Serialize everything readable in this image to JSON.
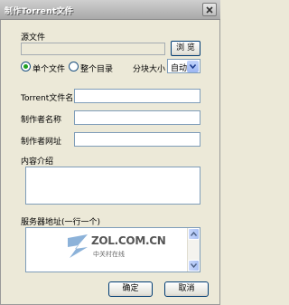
{
  "window": {
    "title": "制作Torrent文件"
  },
  "source": {
    "label": "源文件",
    "value": "",
    "browse_label": "浏 览"
  },
  "mode": {
    "single_file_label": "单个文件",
    "whole_dir_label": "整个目录",
    "selected": "single_file",
    "block_size_label": "分块大小",
    "block_size_value": "自动"
  },
  "fields": {
    "torrent_name_label": "Torrent文件名",
    "torrent_name_value": "",
    "creator_name_label": "制作者名称",
    "creator_name_value": "",
    "creator_url_label": "制作者网址",
    "creator_url_value": ""
  },
  "description": {
    "label": "内容介绍",
    "value": ""
  },
  "servers": {
    "label": "服务器地址(一行一个)",
    "value": ""
  },
  "buttons": {
    "ok_label": "确定",
    "cancel_label": "取消"
  },
  "watermark": {
    "brand": "ZOL.COM.CN",
    "subtitle": "中关村在线"
  }
}
